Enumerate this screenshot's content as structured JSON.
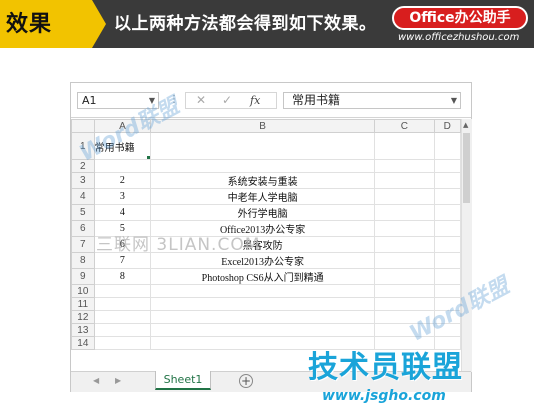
{
  "banner": {
    "tag": "效果",
    "caption": "以上两种方法都会得到如下效果。",
    "brand": "Office办公助手",
    "url": "www.officezhushou.com"
  },
  "formula_bar": {
    "name_box": "A1",
    "fx_label": "fx",
    "content": "常用书籍"
  },
  "columns": [
    "A",
    "B",
    "C",
    "D"
  ],
  "rows": [
    {
      "row": "1",
      "a": "常用书籍",
      "b": ""
    },
    {
      "row": "2",
      "a": "",
      "b": ""
    },
    {
      "row": "3",
      "a": "2",
      "b": "系统安装与重装"
    },
    {
      "row": "4",
      "a": "3",
      "b": "中老年人学电脑"
    },
    {
      "row": "5",
      "a": "4",
      "b": "外行学电脑"
    },
    {
      "row": "6",
      "a": "5",
      "b": "Office2013办公专家"
    },
    {
      "row": "7",
      "a": "6",
      "b": "黑客攻防"
    },
    {
      "row": "8",
      "a": "7",
      "b": "Excel2013办公专家"
    },
    {
      "row": "9",
      "a": "8",
      "b": "Photoshop CS6从入门到精通"
    },
    {
      "row": "10",
      "a": "",
      "b": ""
    },
    {
      "row": "11",
      "a": "",
      "b": ""
    },
    {
      "row": "12",
      "a": "",
      "b": ""
    },
    {
      "row": "13",
      "a": "",
      "b": ""
    },
    {
      "row": "14",
      "a": "",
      "b": ""
    }
  ],
  "sheet_tabs": {
    "active": "Sheet1",
    "add_label": "+"
  },
  "watermarks": {
    "word": "Word联盟",
    "mid": "三联网 3LIAN.COM",
    "logo": "技术员联盟",
    "logo_url": "www.jsgho.com"
  },
  "colors": {
    "excel_green": "#217346",
    "banner_yellow": "#f2c300",
    "brand_red": "#d81e1e"
  }
}
